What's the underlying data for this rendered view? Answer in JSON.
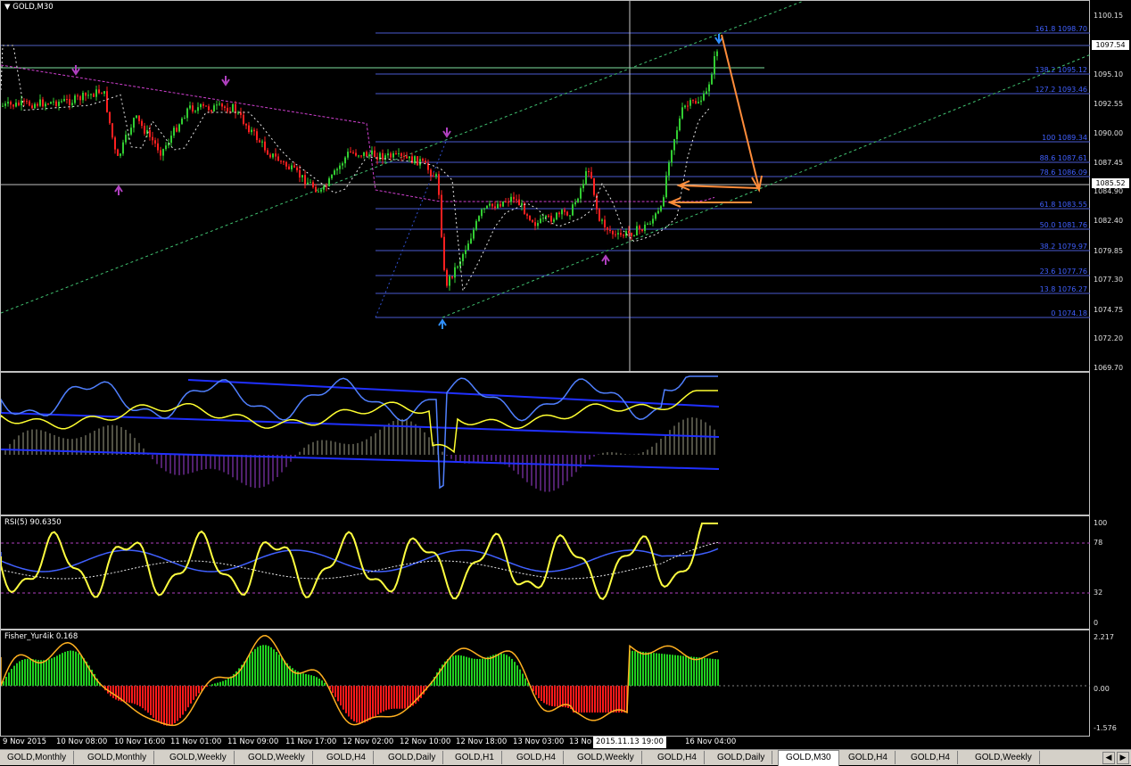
{
  "chart": {
    "title": "GOLD,M30",
    "current_price": "1085.52",
    "last_bar_price": "1097.54",
    "price_axis": [
      "1100.15",
      "1097.54",
      "1095.10",
      "1092.55",
      "1090.00",
      "1087.45",
      "1085.52",
      "1084.90",
      "1082.40",
      "1079.85",
      "1077.30",
      "1074.75",
      "1072.20",
      "1069.70"
    ],
    "fib_levels": [
      "161.8 1098.70",
      "138.2 1095.12",
      "127.2 1093.46",
      "100 1089.34",
      "88.6 1087.61",
      "78.6 1086.09",
      "61.8 1083.55",
      "50.0 1081.76",
      "38.2 1079.97",
      "23.6 1077.76",
      "13.8 1076.27",
      "0 1074.18"
    ]
  },
  "macd": {
    "label": ""
  },
  "rsi": {
    "label": "RSI(5) 90.6350",
    "axis": [
      "100",
      "78",
      "32",
      "0"
    ]
  },
  "fisher": {
    "label": "Fisher_Yur4ik 0.168",
    "axis": [
      "2.217",
      "0.00",
      "-1.576"
    ]
  },
  "time_axis": {
    "labels": [
      "9 Nov 2015",
      "10 Nov 08:00",
      "10 Nov 16:00",
      "11 Nov 01:00",
      "11 Nov 09:00",
      "11 Nov 17:00",
      "12 Nov 02:00",
      "12 Nov 10:00",
      "12 Nov 18:00",
      "13 Nov 03:00",
      "13 No",
      "16 Nov 04:00"
    ],
    "crosshair": "2015.11.13 19:00"
  },
  "tabs": [
    "GOLD,Monthly",
    "GOLD,Monthly",
    "GOLD,Weekly",
    "GOLD,Weekly",
    "GOLD,H4",
    "GOLD,Daily",
    "GOLD,H1",
    "GOLD,H4",
    "GOLD,Weekly",
    "GOLD,H4",
    "GOLD,Daily",
    "GOLD,M30",
    "GOLD,H4",
    "GOLD,H4",
    "GOLD,Weekly"
  ],
  "active_tab": "GOLD,M30",
  "colors": {
    "bull": "#32cd32",
    "bear": "#ff2020",
    "fib": "#4060ff",
    "arrow": "#ff8c3a",
    "rsi": "#ffff40"
  }
}
